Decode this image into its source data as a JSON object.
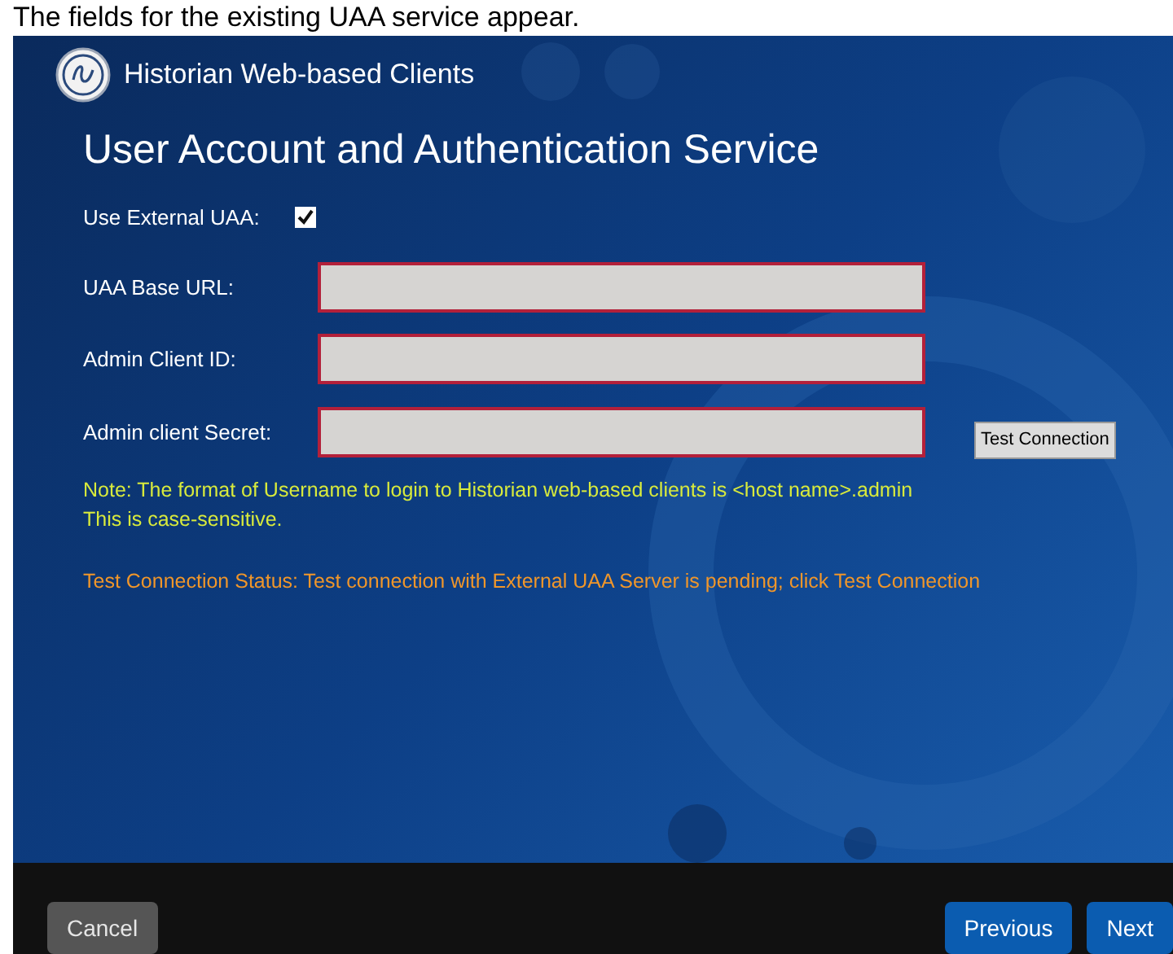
{
  "caption": "The fields for the existing UAA service appear.",
  "header": {
    "title": "Historian Web-based Clients"
  },
  "page_title": "User Account and Authentication Service",
  "external_uaa": {
    "label": "Use External UAA:",
    "checked": true
  },
  "fields": [
    {
      "label": "UAA Base URL:"
    },
    {
      "label": "Admin Client ID:"
    },
    {
      "label": "Admin client Secret:"
    }
  ],
  "test_button": "Test Connection",
  "note": [
    "Note: The format of Username to login to Historian web-based clients is <host name>.admin",
    "This is case-sensitive."
  ],
  "status": "Test Connection Status: Test connection with External UAA Server is pending; click Test Connection",
  "buttons": [
    {
      "label": "Cancel",
      "kind": "secondary"
    },
    {
      "label": "Previous",
      "kind": "primary"
    },
    {
      "label": "Next",
      "kind": "primary"
    }
  ]
}
